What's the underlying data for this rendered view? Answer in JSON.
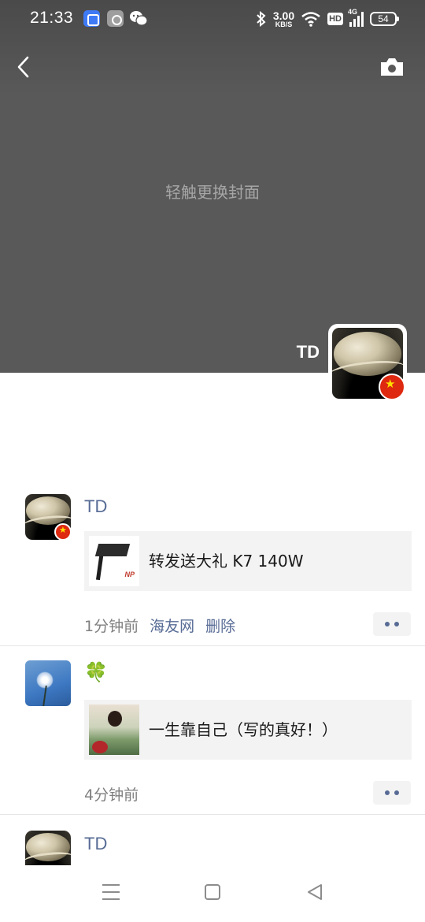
{
  "status_bar": {
    "time": "21:33",
    "speed_value": "3.00",
    "speed_unit": "KB/S",
    "hd": "HD",
    "network": "4G",
    "battery": "54",
    "icons": [
      "blue-app-icon",
      "gear-app-icon",
      "wechat-icon",
      "bluetooth-icon",
      "wifi-icon",
      "signal-icon",
      "battery-icon"
    ]
  },
  "header": {
    "back_icon": "back-icon",
    "camera_icon": "camera-icon",
    "cover_hint": "轻触更换封面"
  },
  "profile": {
    "name": "TD"
  },
  "posts": [
    {
      "author": "TD",
      "share_title": "转发送大礼 K7 140W",
      "thumb_text": "NP",
      "time": "1分钟前",
      "source": "海友网",
      "delete_label": "删除"
    },
    {
      "author": "🍀",
      "share_title": "一生靠自己（写的真好！）",
      "time": "4分钟前"
    },
    {
      "author": "TD"
    }
  ],
  "nav": {
    "icons": [
      "menu-icon",
      "home-icon",
      "back-triangle-icon"
    ]
  },
  "colors": {
    "link": "#576b95",
    "cover": "#595959",
    "meta": "#7f7f7f"
  }
}
